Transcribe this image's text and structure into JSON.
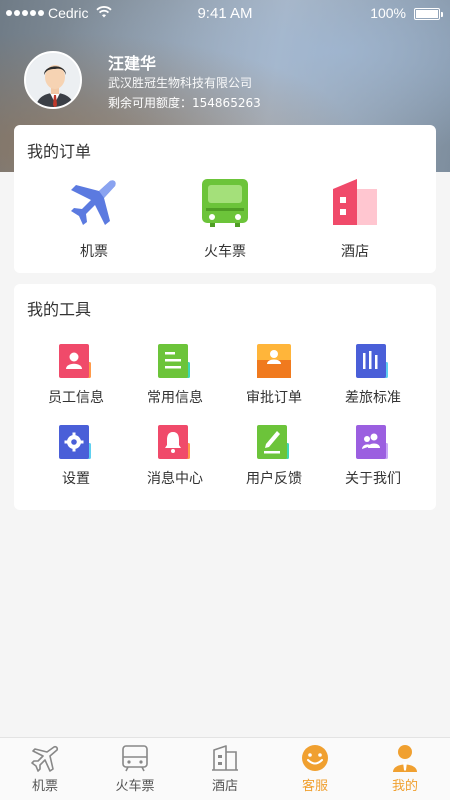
{
  "status_bar": {
    "carrier": "Cedric",
    "time": "9:41 AM",
    "battery": "100%"
  },
  "profile": {
    "name": "汪建华",
    "company": "武汉胜冠生物科技有限公司",
    "credit_label": "剩余可用额度：",
    "credit_value": "154865263"
  },
  "orders": {
    "title": "我的订单",
    "items": [
      {
        "label": "机票",
        "icon": "airplane-icon"
      },
      {
        "label": "火车票",
        "icon": "train-icon"
      },
      {
        "label": "酒店",
        "icon": "hotel-icon"
      }
    ]
  },
  "tools": {
    "title": "我的工具",
    "items": [
      {
        "label": "员工信息",
        "icon": "employee-info-icon"
      },
      {
        "label": "常用信息",
        "icon": "common-info-icon"
      },
      {
        "label": "审批订单",
        "icon": "approve-order-icon"
      },
      {
        "label": "差旅标准",
        "icon": "travel-standard-icon"
      },
      {
        "label": "设置",
        "icon": "settings-icon"
      },
      {
        "label": "消息中心",
        "icon": "message-center-icon"
      },
      {
        "label": "用户反馈",
        "icon": "feedback-icon"
      },
      {
        "label": "关于我们",
        "icon": "about-us-icon"
      }
    ]
  },
  "tabbar": {
    "active": "我的",
    "items": [
      {
        "label": "机票",
        "icon": "airplane-tab-icon"
      },
      {
        "label": "火车票",
        "icon": "train-tab-icon"
      },
      {
        "label": "酒店",
        "icon": "hotel-tab-icon"
      },
      {
        "label": "客服",
        "icon": "customer-service-tab-icon"
      },
      {
        "label": "我的",
        "icon": "profile-tab-icon"
      }
    ]
  },
  "colors": {
    "accent": "#f0a030",
    "tab_inactive": "#888888",
    "airplane": "#5b7ae0",
    "train": "#6cc43a",
    "hotel": "#f04a6a"
  }
}
